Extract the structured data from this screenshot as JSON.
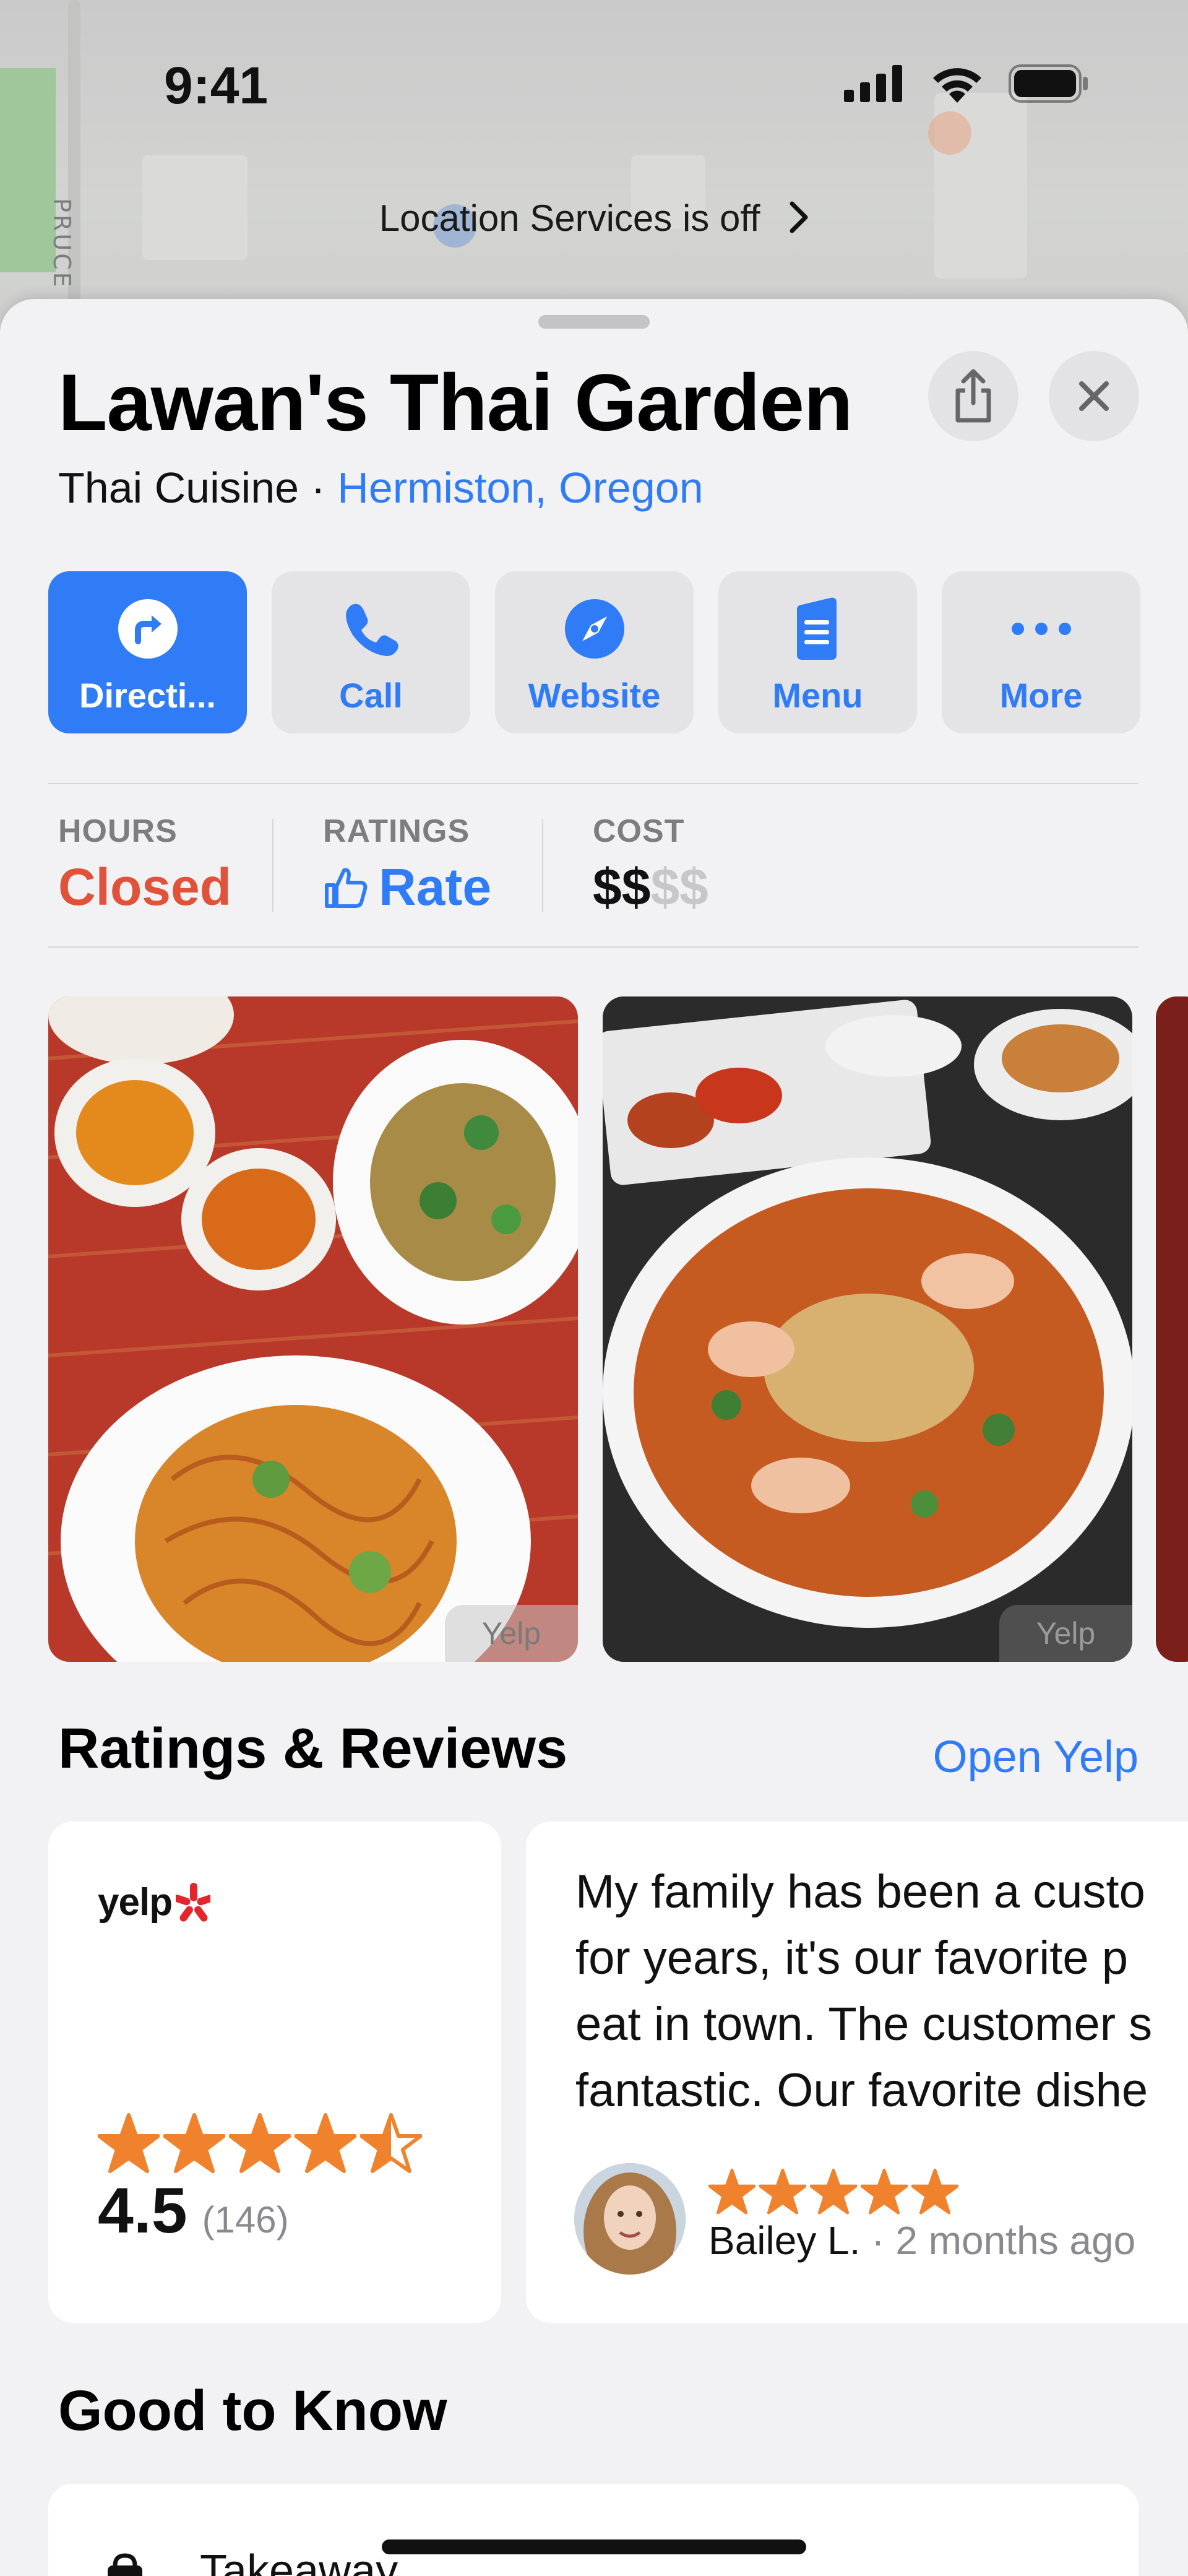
{
  "status_bar": {
    "time": "9:41"
  },
  "map": {
    "street_label": "PRUCE S",
    "banner": "Location Services is off"
  },
  "place": {
    "name": "Lawan's Thai Garden",
    "category": "Thai Cuisine",
    "separator": " · ",
    "location": "Hermiston, Oregon"
  },
  "actions": [
    {
      "label": "Directi...",
      "icon": "directions-icon"
    },
    {
      "label": "Call",
      "icon": "phone-icon"
    },
    {
      "label": "Website",
      "icon": "compass-icon"
    },
    {
      "label": "Menu",
      "icon": "menu-document-icon"
    },
    {
      "label": "More",
      "icon": "ellipsis-icon"
    }
  ],
  "info": {
    "hours_caption": "HOURS",
    "hours_value": "Closed",
    "ratings_caption": "RATINGS",
    "ratings_value": "Rate",
    "cost_caption": "COST",
    "cost_active": "$$",
    "cost_inactive": "$$"
  },
  "photos": [
    {
      "source": "Yelp",
      "subject": "noodles-fried-rice-tea"
    },
    {
      "source": "Yelp",
      "subject": "tom-yum-noodle-soup"
    }
  ],
  "reviews": {
    "title": "Ratings & Reviews",
    "open_link": "Open Yelp",
    "provider": "yelp",
    "rating": "4.5",
    "count": "(146)",
    "rating_value": 4.5,
    "review_lines": [
      "My family has been a custo",
      "for years, it's our favorite p",
      "eat in town. The customer s",
      "fantastic. Our favorite dishe"
    ],
    "reviewer": "Bailey L.",
    "review_time": "2 months ago",
    "review_stars": 5
  },
  "good_to_know": {
    "title": "Good to Know",
    "first_item": "Takeaway"
  },
  "colors": {
    "accent": "#2f7cf6",
    "closed": "#e0523a",
    "star": "#f0822d"
  }
}
